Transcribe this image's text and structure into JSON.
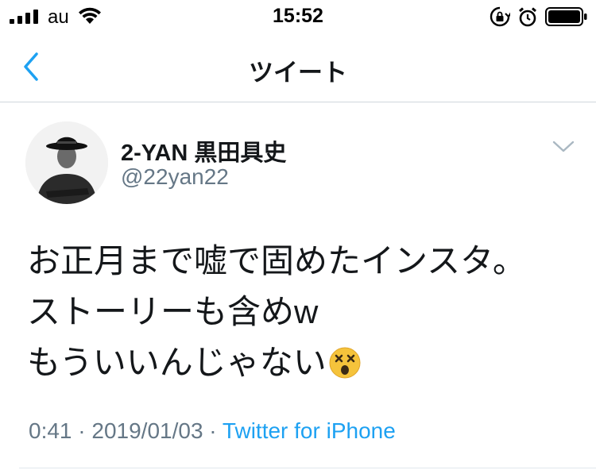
{
  "status_bar": {
    "carrier": "au",
    "time": "15:52"
  },
  "nav": {
    "title": "ツイート",
    "back_icon": "chevron-left-icon"
  },
  "tweet": {
    "display_name": "2-YAN 黒田具史",
    "handle": "@22yan22",
    "lines": [
      "お正月まで嘘で固めたインスタ。",
      "ストーリーも含めw",
      "もういいんじゃない"
    ],
    "emoji": "dizzy-face-emoji",
    "time": "0:41",
    "separator1": " · ",
    "date": "2019/01/03",
    "separator2": " · ",
    "source": "Twitter for iPhone"
  },
  "colors": {
    "accent": "#1da1f2",
    "secondary_text": "#657786",
    "primary_text": "#14171a"
  }
}
